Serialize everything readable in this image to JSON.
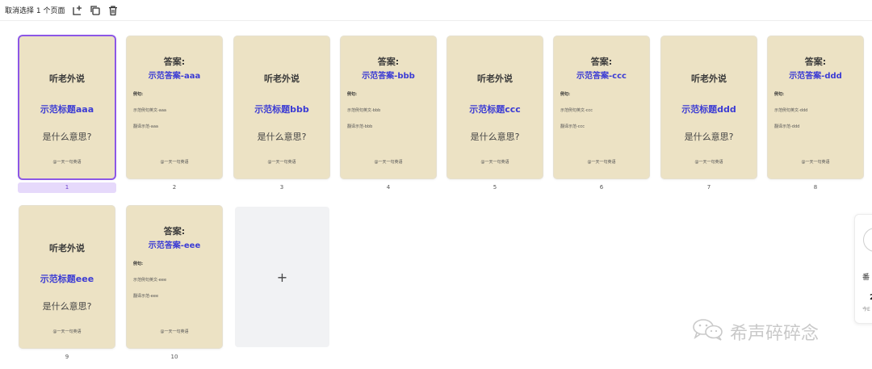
{
  "toolbar": {
    "selection_label": "取消选择 1 个页面",
    "icons": [
      "add-page-icon",
      "duplicate-icon",
      "delete-icon"
    ]
  },
  "pages": [
    {
      "num": "1",
      "type": "title",
      "title": "听老外说",
      "sample": "示范标题aaa",
      "question": "是什么意思?",
      "footer": "@一天一句英语",
      "selected": true
    },
    {
      "num": "2",
      "type": "answer",
      "title": "答案:",
      "answer": "示范答案-aaa",
      "example_label": "例句:",
      "example_en": "示范例句英文-aaa",
      "example_zh": "翻译示范-aaa",
      "footer": "@一天一句英语"
    },
    {
      "num": "3",
      "type": "title",
      "title": "听老外说",
      "sample": "示范标题bbb",
      "question": "是什么意思?",
      "footer": "@一天一句英语"
    },
    {
      "num": "4",
      "type": "answer",
      "title": "答案:",
      "answer": "示范答案-bbb",
      "example_label": "例句:",
      "example_en": "示范例句英文-bbb",
      "example_zh": "翻译示范-bbb",
      "footer": "@一天一句英语"
    },
    {
      "num": "5",
      "type": "title",
      "title": "听老外说",
      "sample": "示范标题ccc",
      "question": "是什么意思?",
      "footer": "@一天一句英语"
    },
    {
      "num": "6",
      "type": "answer",
      "title": "答案:",
      "answer": "示范答案-ccc",
      "example_label": "例句:",
      "example_en": "示范例句英文-ccc",
      "example_zh": "翻译示范-ccc",
      "footer": "@一天一句英语"
    },
    {
      "num": "7",
      "type": "title",
      "title": "听老外说",
      "sample": "示范标题ddd",
      "question": "是什么意思?",
      "footer": "@一天一句英语"
    },
    {
      "num": "8",
      "type": "answer",
      "title": "答案:",
      "answer": "示范答案-ddd",
      "example_label": "例句:",
      "example_en": "示范例句英文-ddd",
      "example_zh": "翻译示范-ddd",
      "footer": "@一天一句英语"
    },
    {
      "num": "9",
      "type": "title",
      "title": "听老外说",
      "sample": "示范标题eee",
      "question": "是什么意思?",
      "footer": "@一天一句英语"
    },
    {
      "num": "10",
      "type": "answer",
      "title": "答案:",
      "answer": "示范答案-eee",
      "example_label": "例句:",
      "example_en": "示范例句英文-eee",
      "example_zh": "翻译示范-eee",
      "footer": "@一天一句英语"
    }
  ],
  "add_page": {
    "symbol": "+"
  },
  "side_panel": {
    "label": "番",
    "number": "2",
    "sublabel": "今E"
  },
  "watermark": {
    "text": "希声碎碎念",
    "icon": "wechat-icon"
  },
  "colors": {
    "accent": "#8c57e6",
    "page_bg": "#ece2c4",
    "highlight_text": "#3b3bd4",
    "selected_num_bg": "#e6d9fb"
  }
}
